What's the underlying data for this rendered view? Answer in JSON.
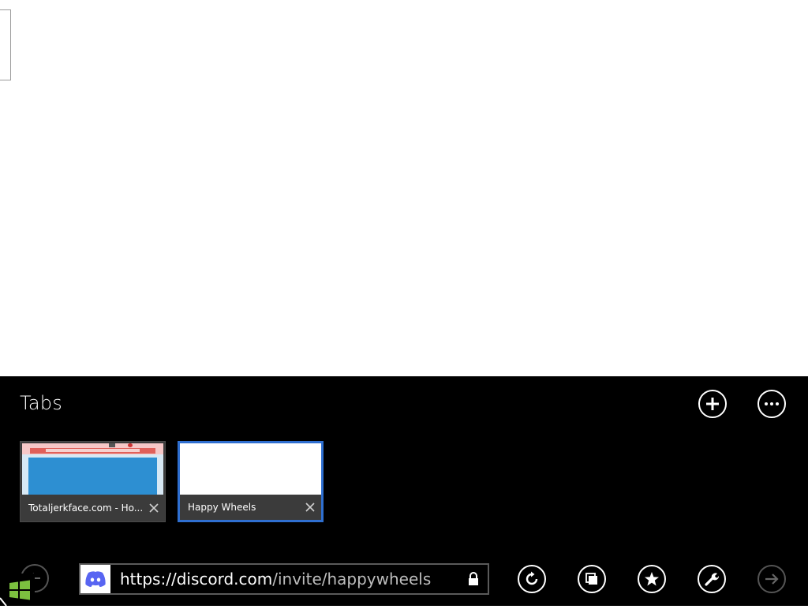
{
  "tabs_panel": {
    "title": "Tabs",
    "new_tab_label": "New tab",
    "more_label": "More"
  },
  "tabs": [
    {
      "title": "Totaljerkface.com - Ho...",
      "close": "✕",
      "active": false
    },
    {
      "title": "Happy Wheels",
      "close": "✕",
      "active": true
    }
  ],
  "address_bar": {
    "url_host": "https://discord.com",
    "url_path": "/invite/happywheels"
  },
  "colors": {
    "appbar_bg": "#000000",
    "active_tab_border": "#2f6fd0",
    "discord_brand": "#5865F2",
    "windows_logo": "#7cc13f"
  },
  "icons": {
    "new_tab": "plus-icon",
    "more": "ellipsis-icon",
    "back": "back-arrow-icon",
    "favicon": "discord-icon",
    "secure": "lock-icon",
    "refresh": "refresh-icon",
    "pin": "pin-icon",
    "favorites": "star-icon",
    "tools": "wrench-icon",
    "forward": "forward-arrow-icon",
    "start": "windows-logo-icon"
  }
}
